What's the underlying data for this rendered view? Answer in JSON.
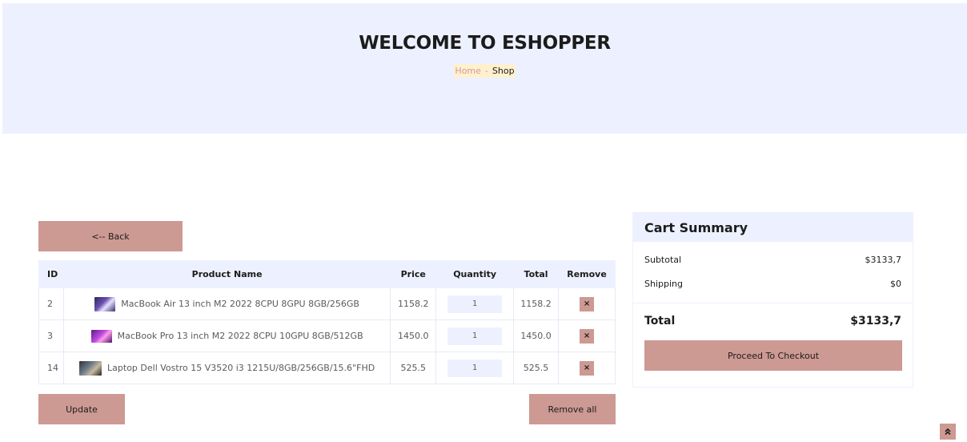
{
  "hero": {
    "title": "WELCOME TO ESHOPPER",
    "breadcrumb": {
      "home": "Home",
      "separator": "-",
      "current": "Shop"
    }
  },
  "buttons": {
    "back": "<-- Back",
    "update": "Update",
    "remove_all": "Remove all"
  },
  "table": {
    "headers": {
      "id": "ID",
      "name": "Product Name",
      "price": "Price",
      "quantity": "Quantity",
      "total": "Total",
      "remove": "Remove"
    },
    "rows": [
      {
        "id": "2",
        "name": "MacBook Air 13 inch M2 2022 8CPU 8GPU 8GB/256GB",
        "price": "1158.2",
        "quantity": "1",
        "total": "1158.2",
        "remove": "×"
      },
      {
        "id": "3",
        "name": "MacBook Pro 13 inch M2 2022 8CPU 10GPU 8GB/512GB",
        "price": "1450.0",
        "quantity": "1",
        "total": "1450.0",
        "remove": "×"
      },
      {
        "id": "14",
        "name": "Laptop Dell Vostro 15 V3520 i3 1215U/8GB/256GB/15.6\"FHD",
        "price": "525.5",
        "quantity": "1",
        "total": "525.5",
        "remove": "×"
      }
    ]
  },
  "summary": {
    "title": "Cart Summary",
    "subtotal_label": "Subtotal",
    "subtotal_value": "$3133,7",
    "shipping_label": "Shipping",
    "shipping_value": "$0",
    "total_label": "Total",
    "total_value": "$3133,7",
    "checkout": "Proceed To Checkout"
  },
  "colors": {
    "accent": "#cd9993",
    "light_bg": "#edf1ff",
    "breadcrumb_bg": "#fff1cf"
  },
  "icons": {
    "remove": "close-icon",
    "scroll_top": "double-chevron-up-icon"
  }
}
